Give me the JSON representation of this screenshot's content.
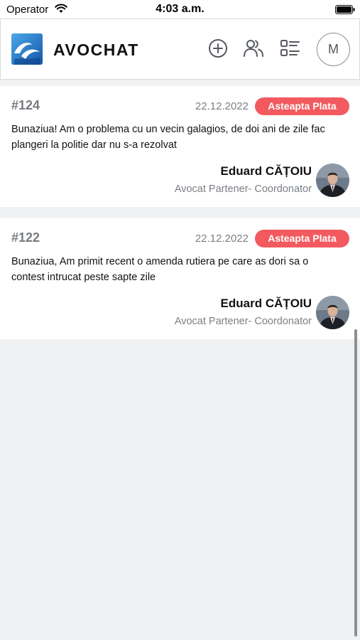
{
  "status_bar": {
    "carrier": "Operator",
    "time": "4:03 a.m.",
    "wifi_icon": "wifi-icon",
    "battery_icon": "battery-icon"
  },
  "header": {
    "title": "AVOCHAT",
    "logo_icon": "avochat-logo-icon",
    "actions": [
      {
        "name": "add-case-button",
        "icon": "plus-circle-icon"
      },
      {
        "name": "users-button",
        "icon": "users-icon"
      },
      {
        "name": "list-view-button",
        "icon": "list-icon"
      }
    ],
    "avatar_initial": "M"
  },
  "cases": [
    {
      "id": "#124",
      "date": "22.12.2022",
      "status": "Asteapta Plata",
      "text_line1": "Bunaziua! Am o problema cu un vecin galagios, de doi ani de zile fac",
      "text_line2": "plangeri la politie dar nu s-a rezolvat",
      "lawyer_name": "Eduard CĂȚOIU",
      "lawyer_role": "Avocat Partener- Coordonator"
    },
    {
      "id": "#122",
      "date": "22.12.2022",
      "status": "Asteapta Plata",
      "text_line1": "Bunaziua, Am primit recent o amenda rutiera pe care as dori sa o",
      "text_line2": "contest intrucat peste sapte zile",
      "lawyer_name": "Eduard CĂȚOIU",
      "lawyer_role": "Avocat Partener- Coordonator"
    }
  ],
  "colors": {
    "accent": "#1a73c9",
    "status_badge": "#f25a5f",
    "background": "#f0f1f2"
  }
}
